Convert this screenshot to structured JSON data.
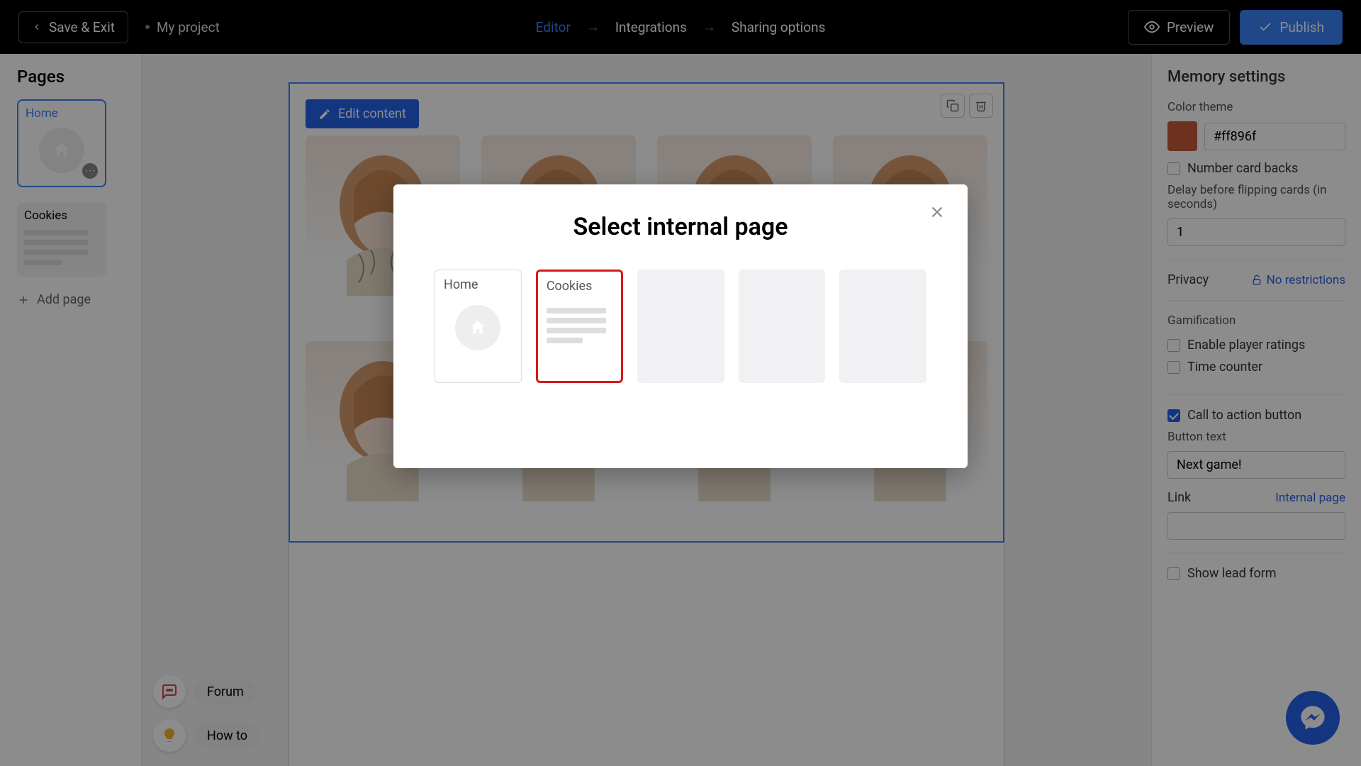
{
  "topbar": {
    "save_exit": "Save & Exit",
    "project_name": "My project",
    "nav": {
      "editor": "Editor",
      "integrations": "Integrations",
      "sharing": "Sharing options"
    },
    "preview": "Preview",
    "publish": "Publish"
  },
  "left": {
    "title": "Pages",
    "pages": [
      {
        "label": "Home"
      },
      {
        "label": "Cookies"
      }
    ],
    "add_page": "Add page"
  },
  "canvas": {
    "edit_content": "Edit content"
  },
  "right": {
    "title": "Memory settings",
    "color_theme_label": "Color theme",
    "color_hex": "#ff896f",
    "number_card_backs": "Number card backs",
    "delay_label": "Delay before flipping cards (in seconds)",
    "delay_value": "1",
    "privacy_label": "Privacy",
    "privacy_value": "No restrictions",
    "gamification_label": "Gamification",
    "enable_ratings": "Enable player ratings",
    "time_counter": "Time counter",
    "cta_label": "Call to action button",
    "button_text_label": "Button text",
    "button_text_value": "Next game!",
    "link_label": "Link",
    "internal_page": "Internal page",
    "show_lead_form": "Show lead form"
  },
  "help": {
    "forum": "Forum",
    "howto": "How to"
  },
  "modal": {
    "title": "Select internal page",
    "options": [
      {
        "label": "Home"
      },
      {
        "label": "Cookies"
      }
    ]
  }
}
